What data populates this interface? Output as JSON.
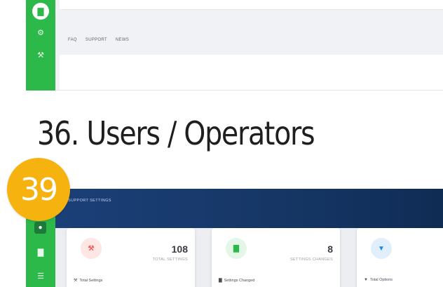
{
  "top_screenshot": {
    "nav_links": [
      "FAQ",
      "SUPPORT",
      "NEWS"
    ],
    "rail_icons": [
      "chart-icon",
      "gear-icon",
      "tools-icon"
    ]
  },
  "heading": "36. Users / Operators",
  "badge": "39",
  "bottom_screenshot": {
    "banner_title": "SUPPORT SETTINGS",
    "cards": [
      {
        "value": "108",
        "subtitle": "TOTAL SETTINGS",
        "footer": "Total Settings",
        "icon": "tools-icon",
        "color": "#f25c54",
        "bg": "#fde6e4"
      },
      {
        "value": "8",
        "subtitle": "SETTINGS CHANGES",
        "footer": "Settings Changed",
        "icon": "chart-icon",
        "color": "#2db84a",
        "bg": "#e3f6e7"
      },
      {
        "value": "",
        "subtitle": "",
        "footer": "Total Options",
        "icon": "filter-icon",
        "color": "#1e88e5",
        "bg": "#e1effc"
      }
    ]
  }
}
